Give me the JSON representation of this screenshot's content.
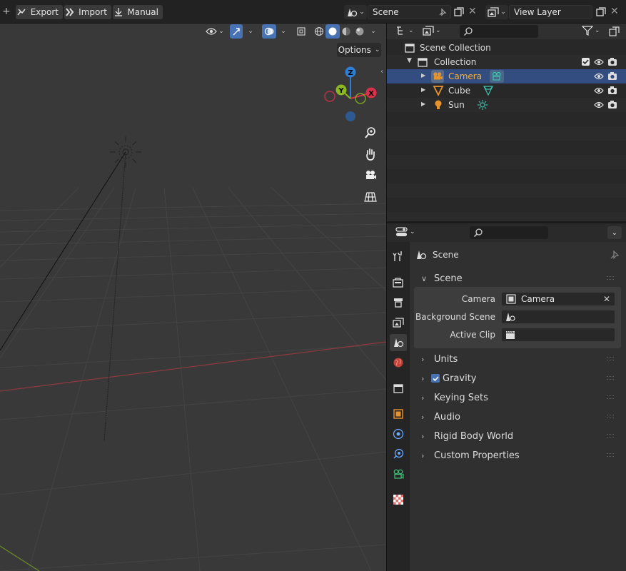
{
  "topbar": {
    "export_label": "Export",
    "import_label": "Import",
    "manual_label": "Manual",
    "scene_name": "Scene",
    "view_layer_name": "View Layer"
  },
  "viewport": {
    "options_label": "Options",
    "gizmo": {
      "z": "Z",
      "y": "Y",
      "x": "X"
    }
  },
  "outliner": {
    "rows": [
      {
        "name": "Scene Collection"
      },
      {
        "name": "Collection"
      },
      {
        "name": "Camera"
      },
      {
        "name": "Cube"
      },
      {
        "name": "Sun"
      }
    ]
  },
  "properties": {
    "context_title": "Scene",
    "panel_scene": "Scene",
    "fields": {
      "camera_label": "Camera",
      "camera_value": "Camera",
      "background_scene_label": "Background Scene",
      "active_clip_label": "Active Clip"
    },
    "panels": [
      "Units",
      "Gravity",
      "Keying Sets",
      "Audio",
      "Rigid Body World",
      "Custom Properties"
    ],
    "gravity_checked": true
  },
  "colors": {
    "selection": "#334d80",
    "accent_blue": "#4772b3",
    "axis_x": "#d9314a",
    "axis_y": "#8bb81c",
    "axis_z": "#2c7fd5",
    "object_orange": "#e8942c"
  }
}
